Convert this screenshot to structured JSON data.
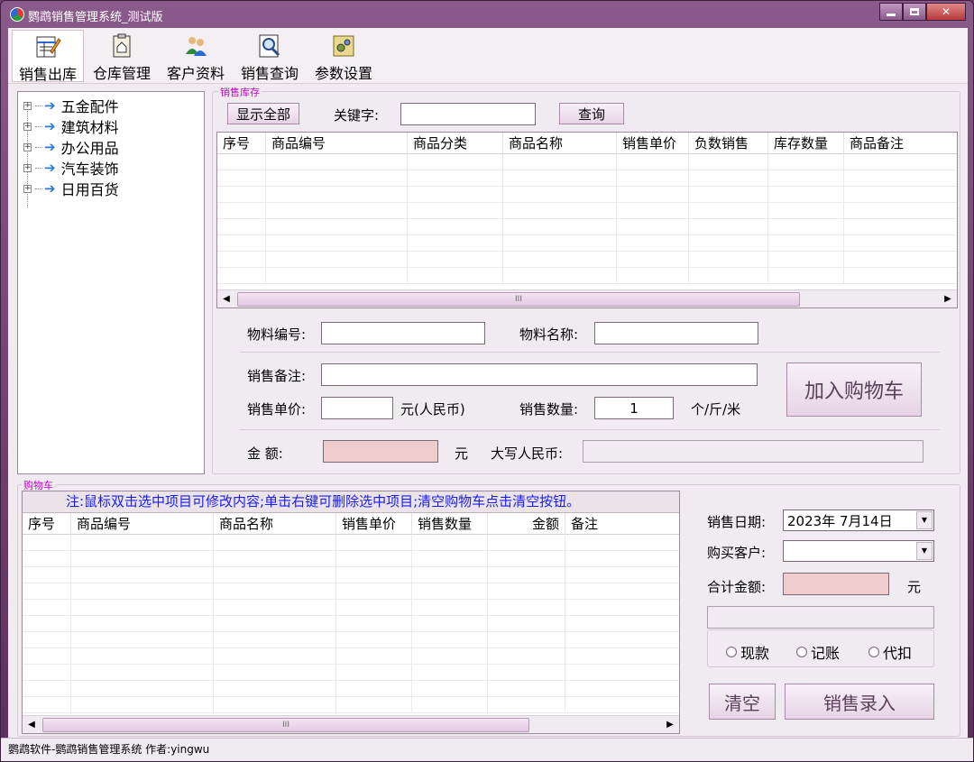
{
  "window": {
    "title": "鹦鹉销售管理系统_测试版",
    "close_glyph": "✕"
  },
  "toolbar": {
    "items": [
      {
        "label": "销售出库",
        "icon": "sales-out-icon"
      },
      {
        "label": "仓库管理",
        "icon": "warehouse-icon"
      },
      {
        "label": "客户资料",
        "icon": "customers-icon"
      },
      {
        "label": "销售查询",
        "icon": "sales-query-icon"
      },
      {
        "label": "参数设置",
        "icon": "settings-icon"
      }
    ]
  },
  "tree": {
    "items": [
      "五金配件",
      "建筑材料",
      "办公用品",
      "汽车装饰",
      "日用百货"
    ]
  },
  "inventory": {
    "group_title": "销售库存",
    "show_all_label": "显示全部",
    "keyword_label": "关键字:",
    "keyword_value": "",
    "query_label": "查询",
    "columns": [
      "序号",
      "商品编号",
      "商品分类",
      "商品名称",
      "销售单价",
      "负数销售",
      "库存数量",
      "商品备注"
    ]
  },
  "form": {
    "material_code_label": "物料编号:",
    "material_code_value": "",
    "material_name_label": "物料名称:",
    "material_name_value": "",
    "remark_label": "销售备注:",
    "remark_value": "",
    "price_label": "销售单价:",
    "price_value": "",
    "price_unit": "元(人民币)",
    "qty_label": "销售数量:",
    "qty_value": "1",
    "qty_unit": "个/斤/米",
    "add_cart_label": "加入购物车",
    "amount_label": "金    额:",
    "amount_value": "",
    "amount_unit": "元",
    "uppercase_label": "大写人民币:",
    "uppercase_value": ""
  },
  "cart": {
    "group_title": "购物车",
    "notice": "注:鼠标双击选中项目可修改内容;单击右键可删除选中项目;清空购物车点击清空按钮。",
    "columns": [
      "序号",
      "商品编号",
      "商品名称",
      "销售单价",
      "销售数量",
      "金额",
      "备注"
    ]
  },
  "checkout": {
    "date_label": "销售日期:",
    "date_value": "2023年 7月14日",
    "customer_label": "购买客户:",
    "customer_value": "",
    "total_label": "合计金额:",
    "total_value": "",
    "total_unit": "元",
    "payment_options": [
      "现款",
      "记账",
      "代扣"
    ],
    "clear_label": "清空",
    "submit_label": "销售录入"
  },
  "statusbar": {
    "text": "鹦鹉软件-鹦鹉销售管理系统 作者:yingwu"
  }
}
